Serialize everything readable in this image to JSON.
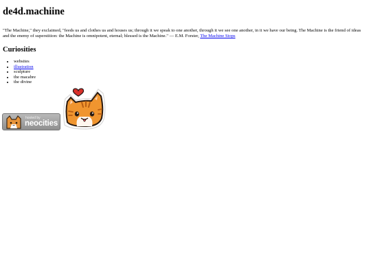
{
  "site": {
    "title": "de4d.machiine"
  },
  "quote": {
    "text": "\"The Machine,\" they exclaimed, \"feeds us and clothes us and houses us; through it we speak to one another, through it we see one another, in it we have our being. The Machine is the friend of ideas and the enemy of superstition: the Machine is omnipotent, eternal; blessed is the Machine.\" — E.M. Forster,",
    "link_label": "The Machine Stops"
  },
  "curiosities": {
    "heading": "Curiosities",
    "items": [
      {
        "label": "websites",
        "link": false
      },
      {
        "label": "illustration",
        "link": true
      },
      {
        "label": "sculpture",
        "link": false
      },
      {
        "label": "the macabre",
        "link": false
      },
      {
        "label": "the divine",
        "link": false
      }
    ]
  },
  "badge": {
    "small_text": "hosted by",
    "brand_text": "neocities"
  }
}
